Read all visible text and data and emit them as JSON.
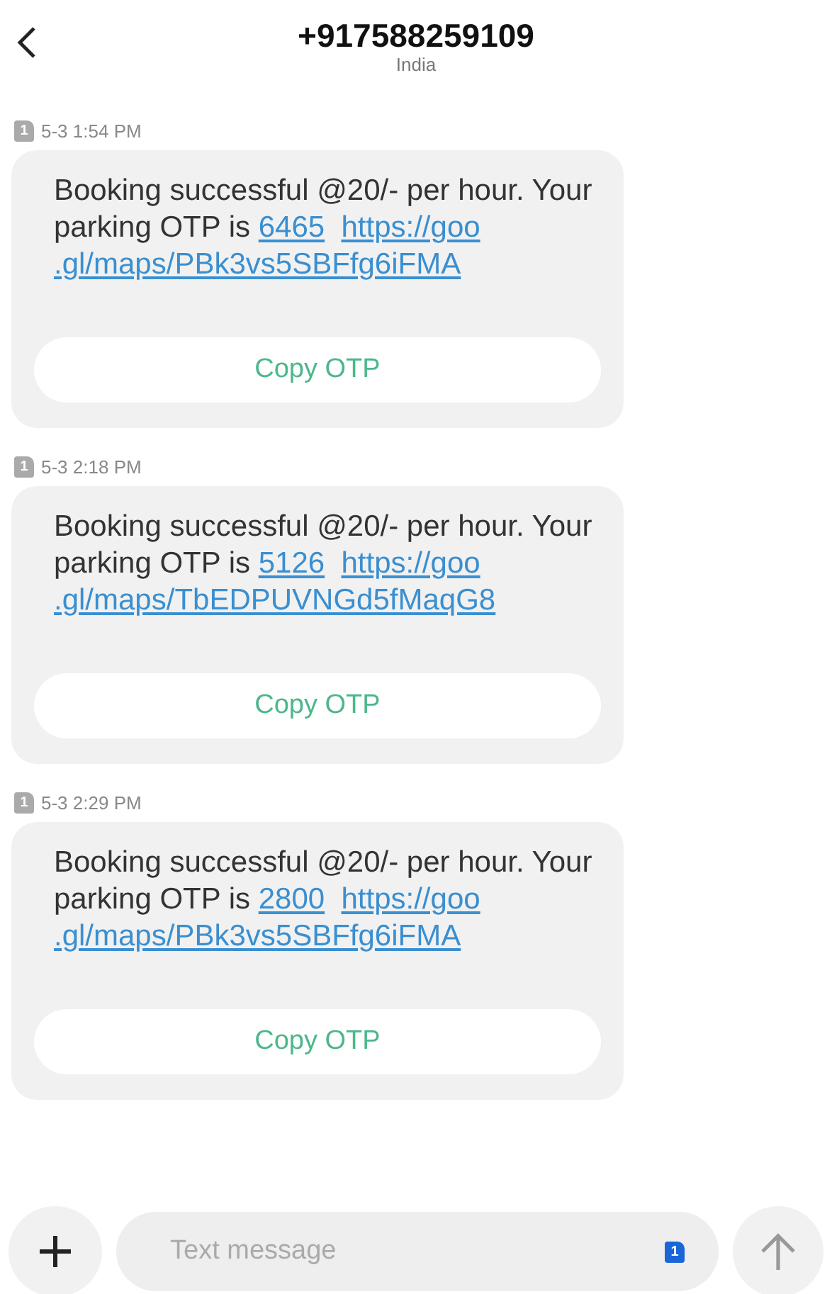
{
  "header": {
    "title": "+917588259109",
    "subtitle": "India"
  },
  "messages": [
    {
      "sim": "1",
      "time": "5-3 1:54 PM",
      "text": "Booking successful @20/- per hour. Your parking OTP is",
      "otp": "6465",
      "url": [
        "https://goo",
        ".gl/maps/PBk3vs5SBFfg6iFMA"
      ],
      "action": "Copy OTP"
    },
    {
      "sim": "1",
      "time": "5-3 2:18 PM",
      "text": "Booking successful @20/- per hour. Your parking OTP is",
      "otp": "5126",
      "url": [
        "https://goo",
        ".gl/maps/TbEDPUVNGd5fMaqG8"
      ],
      "action": "Copy OTP"
    },
    {
      "sim": "1",
      "time": "5-3 2:29 PM",
      "text": "Booking successful @20/- per hour. Your parking OTP is",
      "otp": "2800",
      "url": [
        "https://goo",
        ".gl/maps/PBk3vs5SBFfg6iFMA"
      ],
      "action": "Copy OTP"
    }
  ],
  "composer": {
    "placeholder": "Text message",
    "sim": "1"
  }
}
